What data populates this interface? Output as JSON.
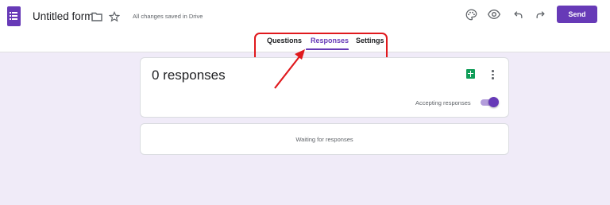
{
  "header": {
    "title": "Untitled form",
    "save_status": "All changes saved in Drive",
    "send_label": "Send",
    "icons": [
      "forms-logo-icon",
      "folder-icon",
      "star-icon",
      "palette-icon",
      "preview-eye-icon",
      "undo-icon",
      "redo-icon"
    ]
  },
  "tabs": [
    {
      "label": "Questions",
      "active": false
    },
    {
      "label": "Responses",
      "active": true
    },
    {
      "label": "Settings",
      "active": false
    }
  ],
  "responses": {
    "count_label": "0 responses",
    "accepting_label": "Accepting responses",
    "accepting": true,
    "waiting_text": "Waiting for responses",
    "icons": [
      "sheets-icon",
      "more-vert-icon"
    ]
  },
  "annotation": {
    "box_color": "#e0191d",
    "arrow_color": "#e0191d"
  },
  "colors": {
    "accent": "#673ab7",
    "background": "#f0ebf8",
    "sheets_green": "#0f9d58"
  }
}
